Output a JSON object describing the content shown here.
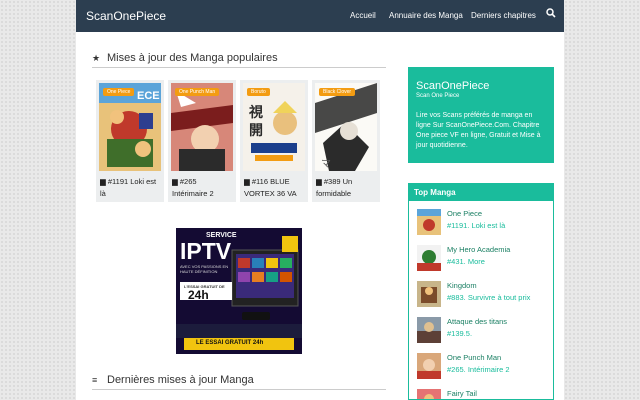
{
  "nav": {
    "brand": "ScanOnePiece",
    "links": [
      "Accueil",
      "Annuaire des Manga",
      "Derniers chapitres"
    ]
  },
  "popular": {
    "title": "Mises à jour des Manga populaires",
    "cards": [
      {
        "tag": "One Piece",
        "caption": "#1191 Loki est là"
      },
      {
        "tag": "One Punch Man",
        "caption": "#265 Intérimaire 2"
      },
      {
        "tag": "Boruto",
        "caption": "#116 BLUE VORTEX 36 VA"
      },
      {
        "tag": "Black Clover",
        "caption": "#389 Un formidable"
      }
    ]
  },
  "ad": {
    "service": "SERVICE",
    "iptv": "IPTV",
    "sub": "AVEC VOS PASSIONS EN HAUTE DÉFINITION",
    "trial_small": "L'ESSAI GRATUIT DE",
    "hours": "24h",
    "cta": "LE ESSAI GRATUIT 24h"
  },
  "latest": {
    "title": "Dernières mises à jour Manga"
  },
  "sidebar": {
    "title": "ScanOnePiece",
    "subtitle": "Scan One Piece",
    "desc": "Lire vos Scans préférés de manga en ligne Sur ScanOnePiece.Com. Chapitre One piece VF en ligne, Gratuit et Mise à jour quotidienne.",
    "top_title": "Top Manga",
    "top": [
      {
        "name": "One Piece",
        "chapter": "#1191. Loki est là"
      },
      {
        "name": "My Hero Academia",
        "chapter": "#431. More"
      },
      {
        "name": "Kingdom",
        "chapter": "#883. Survivre à tout prix"
      },
      {
        "name": "Attaque des titans",
        "chapter": "#139.5."
      },
      {
        "name": "One Punch Man",
        "chapter": "#265. Intérimaire 2"
      },
      {
        "name": "Fairy Tail",
        "chapter": ""
      }
    ]
  }
}
